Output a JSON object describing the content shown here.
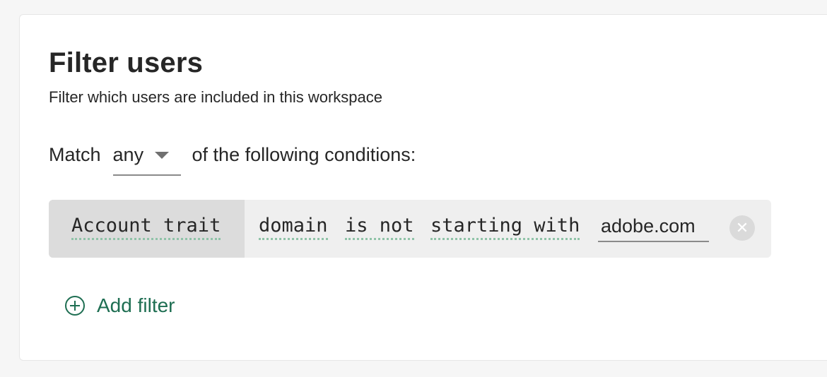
{
  "panel": {
    "title": "Filter users",
    "subtitle": "Filter which users are included in this workspace"
  },
  "match": {
    "prefix": "Match",
    "selected": "any",
    "suffix": "of the following conditions:"
  },
  "filter": {
    "trait_label": "Account trait",
    "field": "domain",
    "operator_tokens": [
      "is not",
      "starting with"
    ],
    "value": "adobe.com",
    "remove_icon": "close-circle-icon"
  },
  "add_filter": {
    "label": "Add filter",
    "icon": "plus-circle-icon"
  },
  "colors": {
    "accent": "#1e6e52",
    "dotted_underline": "#8fc3a8",
    "trait_bg": "#dcdcdc",
    "row_bg": "#efefef"
  }
}
